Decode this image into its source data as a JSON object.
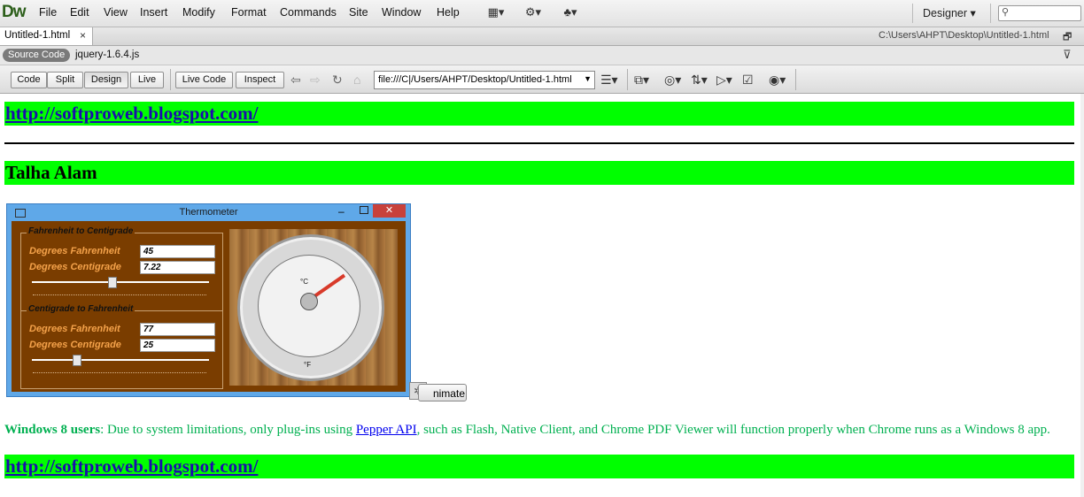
{
  "app": {
    "logo": "Dw"
  },
  "menu": [
    "File",
    "Edit",
    "View",
    "Insert",
    "Modify",
    "Format",
    "Commands",
    "Site",
    "Window",
    "Help"
  ],
  "toolbar_icons": [
    "layout-icon",
    "extend-icon",
    "site-icon"
  ],
  "workspace": {
    "label": "Designer",
    "arrow": "▾"
  },
  "tab": {
    "title": "Untitled-1.html",
    "close": "×",
    "path": "C:\\Users\\AHPT\\Desktop\\Untitled-1.html"
  },
  "related": {
    "source": "Source Code",
    "file": "jquery-1.6.4.js"
  },
  "doc_toolbar": {
    "code": "Code",
    "split": "Split",
    "design": "Design",
    "live": "Live",
    "live_code": "Live Code",
    "inspect": "Inspect",
    "url": "file:///C|/Users/AHPT/Desktop/Untitled-1.html"
  },
  "page": {
    "link_top": "http://softproweb.blogspot.com/",
    "heading": "Talha Alam",
    "link_bottom": "http://softproweb.blogspot.com/",
    "note_bold": "Windows 8 users",
    "note_before": ": Due to system limitations, only plug-ins using ",
    "note_link": "Pepper API",
    "note_after": ", such as Flash, Native Client, and Chrome PDF Viewer will function properly when Chrome runs as a Windows 8 app.",
    "animate": "nimate"
  },
  "thermometer": {
    "title": "Thermometer",
    "group1": {
      "legend": "Fahrenheit to Centigrade",
      "label_f": "Degrees Fahrenheit",
      "val_f": "45",
      "label_c": "Degrees Centigrade",
      "val_c": "7.22",
      "slider": 0.45
    },
    "group2": {
      "legend": "Centigrade to Fahrenheit",
      "label_f": "Degrees Fahrenheit",
      "val_f": "77",
      "label_c": "Degrees Centigrade",
      "val_c": "25",
      "slider": 0.25
    },
    "dial_c": "°C",
    "dial_f": "°F"
  },
  "colors": {
    "green": "#00ff00",
    "note": "#00b050",
    "link": "#1a0dab"
  }
}
